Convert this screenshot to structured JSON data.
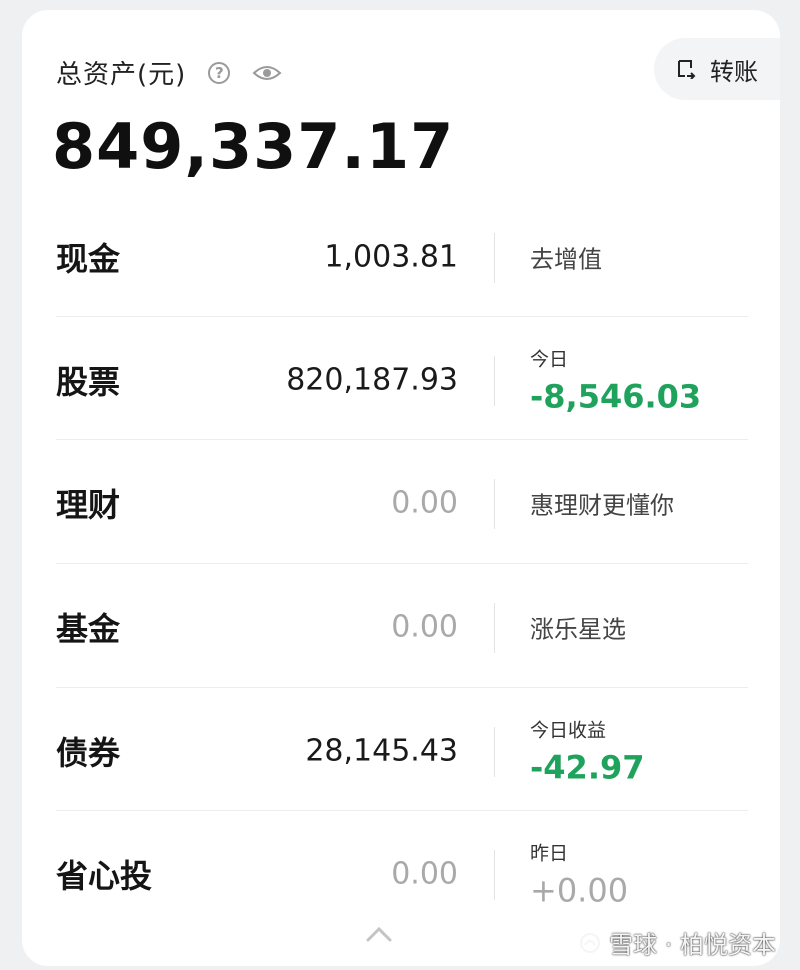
{
  "header": {
    "title": "总资产(元)",
    "help_icon": "question-circle-icon",
    "eye_icon": "eye-icon",
    "transfer_label": "转账",
    "total": "849,337.17"
  },
  "rows": [
    {
      "name": "现金",
      "amount": "1,003.81",
      "right_text": "去增值"
    },
    {
      "name": "股票",
      "amount": "820,187.93",
      "right_label": "今日",
      "right_value": "-8,546.03"
    },
    {
      "name": "理财",
      "amount": "0.00",
      "right_text": "惠理财更懂你"
    },
    {
      "name": "基金",
      "amount": "0.00",
      "right_text": "涨乐星选"
    },
    {
      "name": "债券",
      "amount": "28,145.43",
      "right_label": "今日收益",
      "right_value": "-42.97"
    },
    {
      "name": "省心投",
      "amount": "0.00",
      "right_label": "昨日",
      "right_value": "+0.00"
    }
  ],
  "watermark": "雪球 · 柏悦资本",
  "colors": {
    "negative": "#1fa35c",
    "muted": "#a9a9a9"
  }
}
